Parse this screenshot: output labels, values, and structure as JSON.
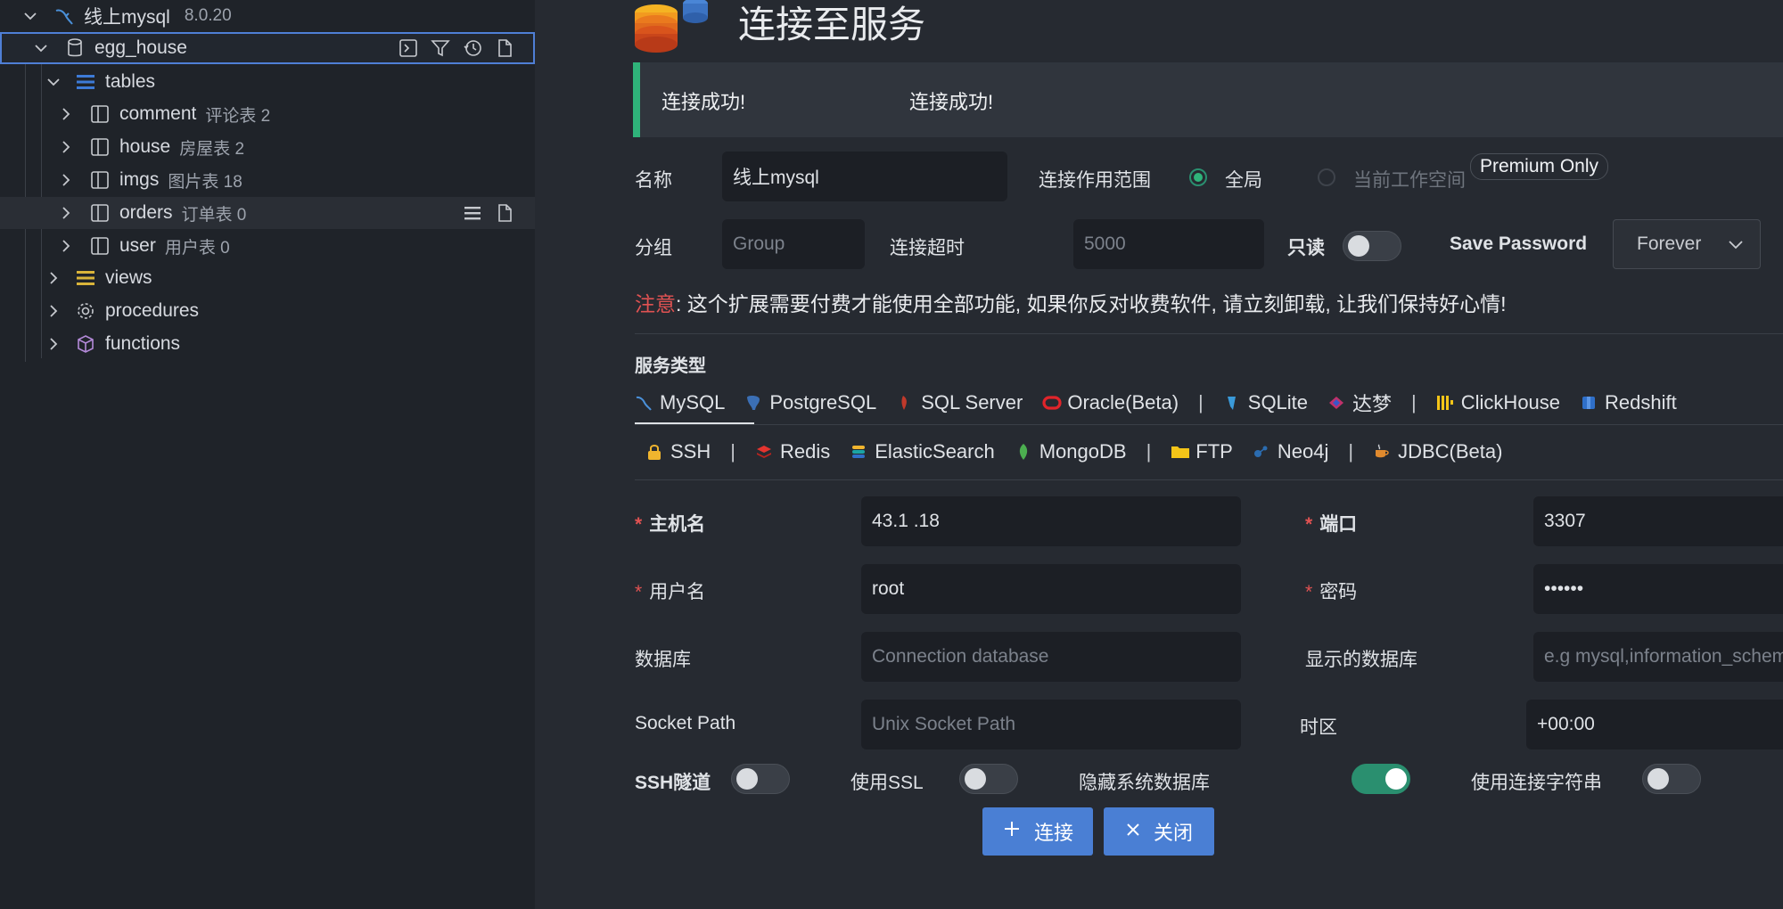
{
  "sidebar": {
    "connection": {
      "name": "线上mysql",
      "version": "8.0.20"
    },
    "database": {
      "name": "egg_house"
    },
    "tables_label": "tables",
    "tables": [
      {
        "name": "comment",
        "note": "评论表 2"
      },
      {
        "name": "house",
        "note": "房屋表 2"
      },
      {
        "name": "imgs",
        "note": "图片表 18"
      },
      {
        "name": "orders",
        "note": "订单表 0"
      },
      {
        "name": "user",
        "note": "用户表 0"
      }
    ],
    "views_label": "views",
    "procedures_label": "procedures",
    "functions_label": "functions"
  },
  "main": {
    "title": "连接至服务",
    "banner": {
      "msg1": "连接成功!",
      "msg2": "连接成功!"
    },
    "name_label": "名称",
    "name_value": "线上mysql",
    "scope_label": "连接作用范围",
    "scope_global": "全局",
    "scope_workspace": "当前工作空间",
    "premium_badge": "Premium Only",
    "group_label": "分组",
    "group_placeholder": "Group",
    "timeout_label": "连接超时",
    "timeout_placeholder": "5000",
    "readonly_label": "只读",
    "save_password_label": "Save Password",
    "save_password_value": "Forever",
    "notice_prefix": "注意",
    "notice_text": ": 这个扩展需要付费才能使用全部功能, 如果你反对收费软件, 请立刻卸载, 让我们保持好心情!",
    "service_type_label": "服务类型",
    "tabs_row1": [
      "MySQL",
      "PostgreSQL",
      "SQL Server",
      "Oracle(Beta)",
      "SQLite",
      "达梦",
      "ClickHouse",
      "Redshift"
    ],
    "tabs_row2": [
      "SSH",
      "Redis",
      "ElasticSearch",
      "MongoDB",
      "FTP",
      "Neo4j",
      "JDBC(Beta)"
    ],
    "separator": "|",
    "host_label": "主机名",
    "host_value": "43.1 .18",
    "port_label": "端口",
    "port_value": "3307",
    "user_label": "用户名",
    "user_value": "root",
    "password_label": "密码",
    "password_value": "••••••",
    "database_label": "数据库",
    "database_placeholder": "Connection database",
    "shown_db_label": "显示的数据库",
    "shown_db_placeholder": "e.g mysql,information_schema",
    "socket_label": "Socket Path",
    "socket_placeholder": "Unix Socket Path",
    "timezone_label": "时区",
    "timezone_value": "+00:00",
    "ssh_tunnel_label": "SSH隧道",
    "use_ssl_label": "使用SSL",
    "hide_system_db_label": "隐藏系统数据库",
    "use_conn_string_label": "使用连接字符串",
    "connect_button": "连接",
    "close_button": "关闭",
    "required_mark": "*"
  },
  "colors": {
    "accent": "#4a7fd4",
    "success": "#2fb37a",
    "danger": "#e05252",
    "toggle_on": "#2a8f6f"
  }
}
